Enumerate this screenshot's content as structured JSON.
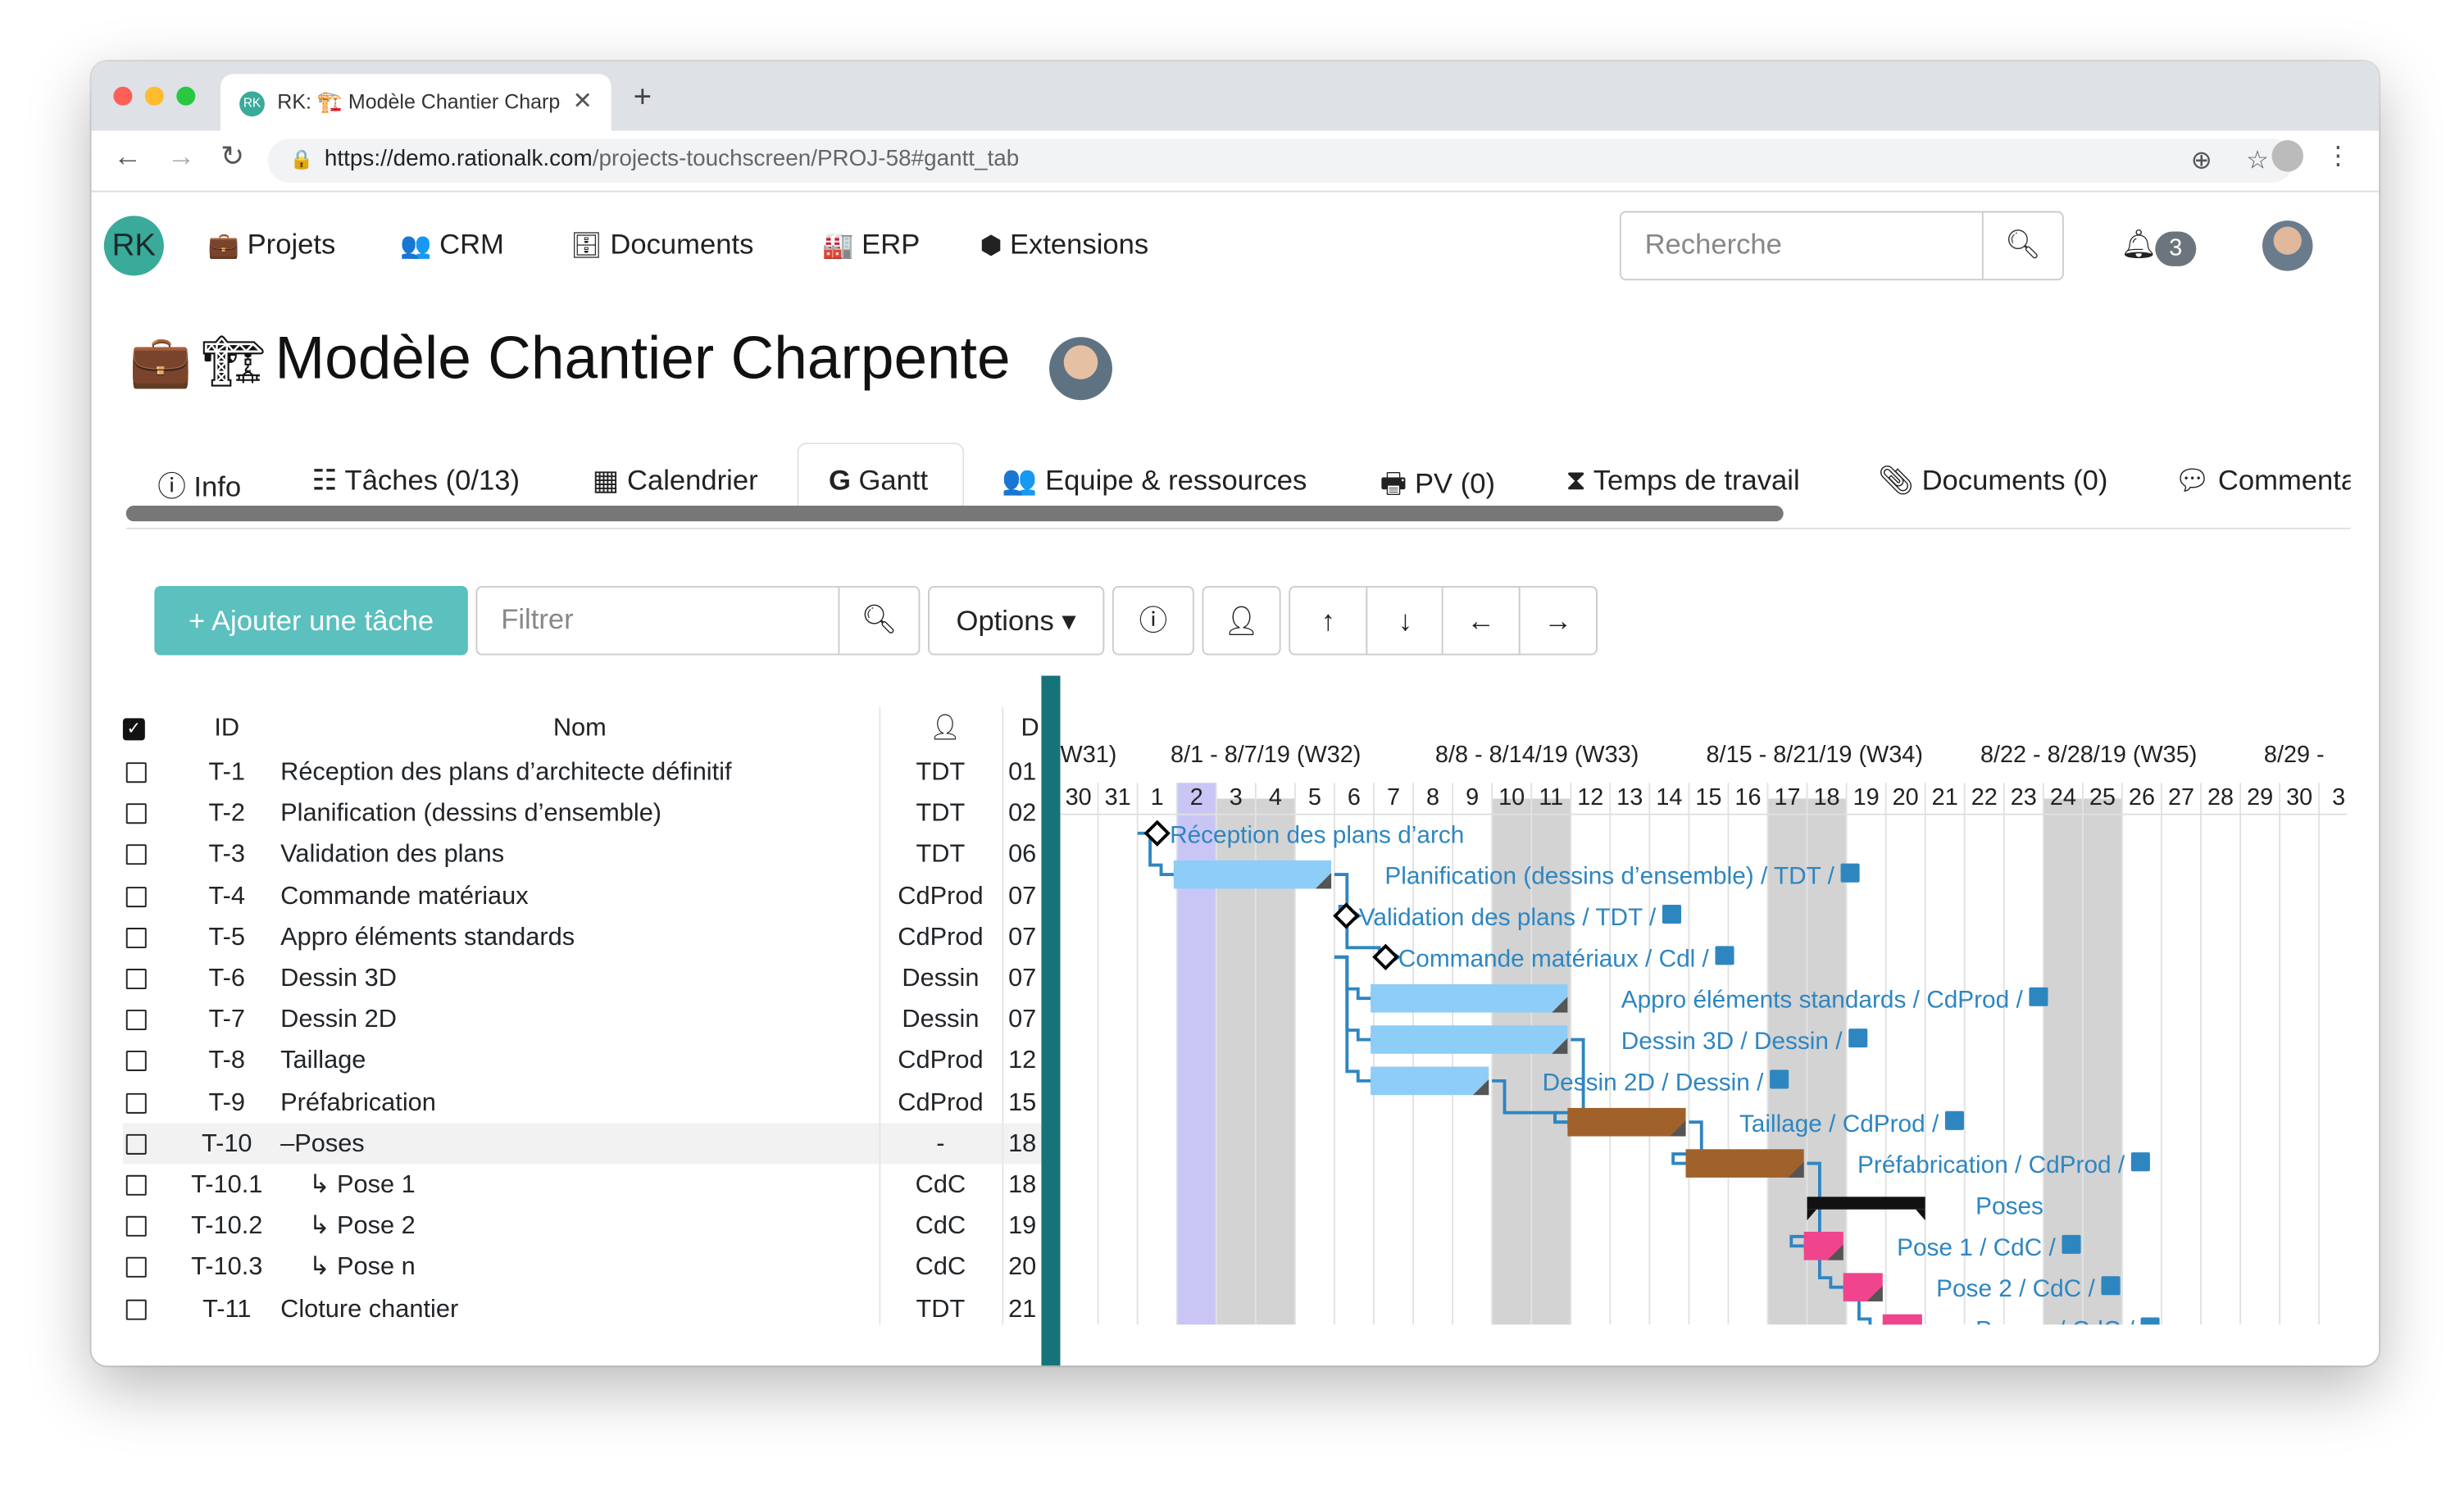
{
  "browser": {
    "tab_title": "RK: 🏗️ Modèle Chantier Charpente",
    "favicon_text": "RK",
    "url_host": "https://demo.rationalk.com",
    "url_path": "/projects-touchscreen/PROJ-58#gantt_tab"
  },
  "app": {
    "logo": "RK",
    "nav": [
      {
        "label": "Projets",
        "icon": "briefcase-icon"
      },
      {
        "label": "CRM",
        "icon": "users-icon"
      },
      {
        "label": "Documents",
        "icon": "database-icon"
      },
      {
        "label": "ERP",
        "icon": "industry-icon"
      },
      {
        "label": "Extensions",
        "icon": "cubes-icon"
      }
    ],
    "search_placeholder": "Recherche",
    "notifications": "3"
  },
  "project": {
    "title": "Modèle Chantier Charpente",
    "tabs": [
      {
        "label": "Info",
        "icon": "info-icon"
      },
      {
        "label": "Tâches (0/13)",
        "icon": "tasks-icon"
      },
      {
        "label": "Calendrier",
        "icon": "calendar-icon"
      },
      {
        "label": "Gantt",
        "icon": "google-g-icon"
      },
      {
        "label": "Equipe & ressources",
        "icon": "users-icon"
      },
      {
        "label": "PV (0)",
        "icon": "printer-icon"
      },
      {
        "label": "Temps de travail",
        "icon": "hourglass-icon"
      },
      {
        "label": "Documents (0)",
        "icon": "paperclip-icon"
      },
      {
        "label": "Commenta",
        "icon": "comments-icon"
      }
    ],
    "active_tab": "Gantt"
  },
  "toolbar": {
    "add_task": "Ajouter une tâche",
    "filter_placeholder": "Filtrer",
    "options": "Options"
  },
  "grid": {
    "headers": {
      "id": "ID",
      "name": "Nom",
      "date": "D"
    },
    "rows": [
      {
        "id": "T-1",
        "name": "Réception des plans d’architecte définitif",
        "res": "TDT",
        "d": "01",
        "indent": false
      },
      {
        "id": "T-2",
        "name": "Planification (dessins d’ensemble)",
        "res": "TDT",
        "d": "02",
        "indent": false
      },
      {
        "id": "T-3",
        "name": "Validation des plans",
        "res": "TDT",
        "d": "06",
        "indent": false
      },
      {
        "id": "T-4",
        "name": "Commande matériaux",
        "res": "CdProd",
        "d": "07",
        "indent": false
      },
      {
        "id": "T-5",
        "name": "Appro éléments standards",
        "res": "CdProd",
        "d": "07",
        "indent": false
      },
      {
        "id": "T-6",
        "name": "Dessin 3D",
        "res": "Dessin",
        "d": "07",
        "indent": false
      },
      {
        "id": "T-7",
        "name": "Dessin 2D",
        "res": "Dessin",
        "d": "07",
        "indent": false
      },
      {
        "id": "T-8",
        "name": "Taillage",
        "res": "CdProd",
        "d": "12",
        "indent": false
      },
      {
        "id": "T-9",
        "name": "Préfabrication",
        "res": "CdProd",
        "d": "15",
        "indent": false
      },
      {
        "id": "T-10",
        "name": "–Poses",
        "res": "-",
        "d": "18",
        "indent": false
      },
      {
        "id": "T-10.1",
        "name": "↳ Pose 1",
        "res": "CdC",
        "d": "18",
        "indent": true
      },
      {
        "id": "T-10.2",
        "name": "↳ Pose 2",
        "res": "CdC",
        "d": "19",
        "indent": true
      },
      {
        "id": "T-10.3",
        "name": "↳ Pose n",
        "res": "CdC",
        "d": "20",
        "indent": true
      },
      {
        "id": "T-11",
        "name": "Cloture chantier",
        "res": "TDT",
        "d": "21",
        "indent": false
      }
    ]
  },
  "gantt": {
    "weeks": [
      "W31)",
      "8/1 - 8/7/19 (W32)",
      "8/8 - 8/14/19 (W33)",
      "8/15 - 8/21/19 (W34)",
      "8/22 - 8/28/19 (W35)",
      "8/29 - "
    ],
    "days": [
      "30",
      "31",
      "1",
      "2",
      "3",
      "4",
      "5",
      "6",
      "7",
      "8",
      "9",
      "10",
      "11",
      "12",
      "13",
      "14",
      "15",
      "16",
      "17",
      "18",
      "19",
      "20",
      "21",
      "22",
      "23",
      "24",
      "25",
      "26",
      "27",
      "28",
      "29",
      "30",
      "3"
    ],
    "weekend_days": [
      4,
      5,
      11,
      12,
      18,
      19,
      25,
      26
    ],
    "today_index": 3,
    "tasks": [
      {
        "label": "Réception des plans d’arch",
        "res": "",
        "type": "milestone",
        "start": 2.5,
        "len": 0,
        "color": "#000000"
      },
      {
        "label": "Planification (dessins d’ensemble)",
        "res": "TDT",
        "type": "bar",
        "start": 3,
        "len": 4,
        "color": "#8ecdf7"
      },
      {
        "label": "Validation des plans",
        "res": "TDT",
        "type": "milestone",
        "start": 7.3,
        "len": 0,
        "color": "#000000"
      },
      {
        "label": "Commande matériaux",
        "res": "Cdl",
        "type": "milestone",
        "start": 8.3,
        "len": 0,
        "color": "#000000"
      },
      {
        "label": "Appro éléments standards",
        "res": "CdProd",
        "type": "bar",
        "start": 8,
        "len": 5,
        "color": "#8ecdf7"
      },
      {
        "label": "Dessin 3D",
        "res": "Dessin",
        "type": "bar",
        "start": 8,
        "len": 5,
        "color": "#8ecdf7"
      },
      {
        "label": "Dessin 2D",
        "res": "Dessin",
        "type": "bar",
        "start": 8,
        "len": 3,
        "color": "#8ecdf7"
      },
      {
        "label": "Taillage",
        "res": "CdProd",
        "type": "bar",
        "start": 13,
        "len": 3,
        "color": "#a0612a"
      },
      {
        "label": "Préfabrication",
        "res": "CdProd",
        "type": "bar",
        "start": 16,
        "len": 3,
        "color": "#a0612a"
      },
      {
        "label": "Poses",
        "res": "",
        "type": "summary",
        "start": 19,
        "len": 3,
        "color": "#111111"
      },
      {
        "label": "Pose 1",
        "res": "CdC",
        "type": "bar",
        "start": 19,
        "len": 1,
        "color": "#f0448c"
      },
      {
        "label": "Pose 2",
        "res": "CdC",
        "type": "bar",
        "start": 20,
        "len": 1,
        "color": "#f0448c"
      },
      {
        "label": "Pose n",
        "res": "CdC",
        "type": "bar",
        "start": 21,
        "len": 1,
        "color": "#f0448c"
      },
      {
        "label": "Cloture chantier",
        "res": "TDT",
        "type": "milestone",
        "start": 22.3,
        "len": 0,
        "color": "#000000"
      }
    ],
    "colors": {
      "weekend": "#d3d3d3",
      "today": "#c9c6f5",
      "link": "#2e86c1",
      "label": "#2e86c1"
    }
  }
}
